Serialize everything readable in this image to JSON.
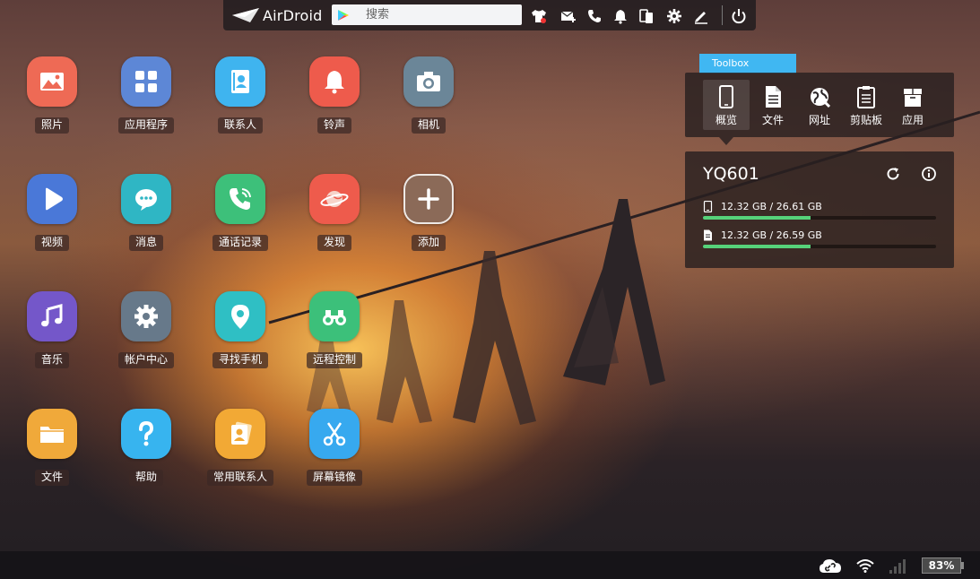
{
  "topbar": {
    "logo_text": "AirDroid",
    "search_placeholder": "搜索",
    "icons": [
      "tshirt-icon",
      "mail-add-icon",
      "phone-icon",
      "bell-icon",
      "copy-devices-icon",
      "gear-icon",
      "pen-icon",
      "power-icon"
    ]
  },
  "apps": [
    {
      "label": "照片",
      "color": "#ee6a55",
      "icon": "photo-icon"
    },
    {
      "label": "应用程序",
      "color": "#5d87d6",
      "icon": "grid-icon"
    },
    {
      "label": "联系人",
      "color": "#3fb4ef",
      "icon": "contacts-icon"
    },
    {
      "label": "铃声",
      "color": "#ee5b4c",
      "icon": "bell-icon"
    },
    {
      "label": "相机",
      "color": "#6b8698",
      "icon": "camera-icon"
    },
    {
      "label": "视频",
      "color": "#4a78d8",
      "icon": "play-icon"
    },
    {
      "label": "消息",
      "color": "#2fb6c4",
      "icon": "chat-icon"
    },
    {
      "label": "通话记录",
      "color": "#3dc07a",
      "icon": "phone-call-icon"
    },
    {
      "label": "发现",
      "color": "#ee5b4c",
      "icon": "planet-icon"
    },
    {
      "label": "添加",
      "color": "#8b6a58",
      "icon": "plus-icon"
    },
    {
      "label": "音乐",
      "color": "#7457c9",
      "icon": "music-icon"
    },
    {
      "label": "帐户中心",
      "color": "#67798a",
      "icon": "gear-icon"
    },
    {
      "label": "寻找手机",
      "color": "#2fbfc4",
      "icon": "location-icon"
    },
    {
      "label": "远程控制",
      "color": "#3cc07a",
      "icon": "binoculars-icon"
    },
    {
      "label": "文件",
      "color": "#f0a93a",
      "icon": "folder-icon"
    },
    {
      "label": "帮助",
      "color": "#37b4ef",
      "icon": "question-icon"
    },
    {
      "label": "常用联系人",
      "color": "#f2a935",
      "icon": "favorite-contacts-icon"
    },
    {
      "label": "屏幕镜像",
      "color": "#37a9ef",
      "icon": "scissors-icon"
    }
  ],
  "toolbox": {
    "tab_label": "Toolbox",
    "tools": [
      {
        "label": "概览",
        "icon": "phone-icon",
        "active": true
      },
      {
        "label": "文件",
        "icon": "document-icon",
        "active": false
      },
      {
        "label": "网址",
        "icon": "globe-icon",
        "active": false
      },
      {
        "label": "剪贴板",
        "icon": "clipboard-icon",
        "active": false
      },
      {
        "label": "应用",
        "icon": "box-icon",
        "active": false
      }
    ]
  },
  "device": {
    "name": "YQ601",
    "storage": [
      {
        "icon": "phone-storage-icon",
        "text": "12.32 GB / 26.61 GB",
        "fraction": 0.463
      },
      {
        "icon": "sd-card-icon",
        "text": "12.32 GB / 26.59 GB",
        "fraction": 0.463
      }
    ]
  },
  "statusbar": {
    "battery_text": "83%",
    "icons": [
      "cloud-link-icon",
      "wifi-icon",
      "signal-icon"
    ]
  }
}
